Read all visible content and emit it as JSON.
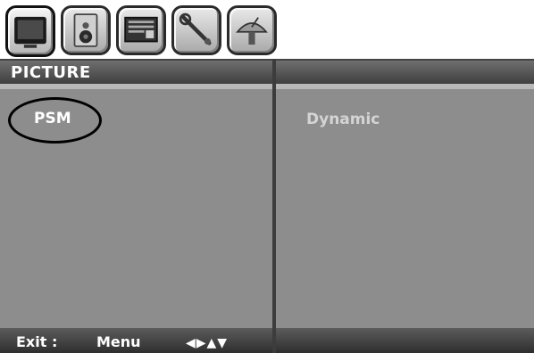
{
  "tabs": [
    {
      "icon": "tv-screen-icon",
      "active": true
    },
    {
      "icon": "speaker-icon",
      "active": false
    },
    {
      "icon": "teletext-icon",
      "active": false
    },
    {
      "icon": "wrench-icon",
      "active": false
    },
    {
      "icon": "satellite-dish-icon",
      "active": false
    }
  ],
  "header": {
    "title": "PICTURE"
  },
  "menu": {
    "item_label": "PSM",
    "item_value": "Dynamic"
  },
  "footer": {
    "exit_label": "Exit :",
    "menu_label": "Menu",
    "nav_arrows": "◀▶▲▼"
  },
  "colors": {
    "panel": "#8d8d8d",
    "titlebar": "#4f4f4f",
    "text": "#ffffff",
    "value_text": "#d4d4d4"
  }
}
